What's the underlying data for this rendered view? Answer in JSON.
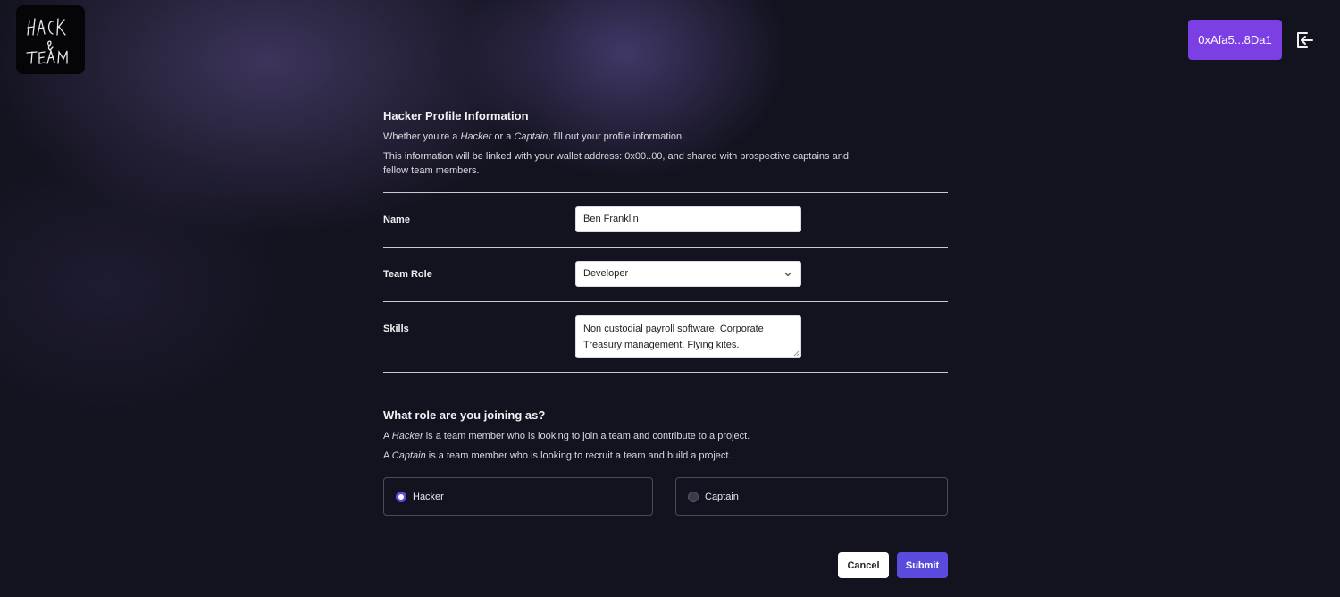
{
  "header": {
    "logo_text": "HACK & TEAM",
    "wallet_label": "0xAfa5...8Da1",
    "logout_icon": "logout-icon"
  },
  "profile": {
    "title": "Hacker Profile Information",
    "intro_prefix": "Whether you're a ",
    "intro_hacker": "Hacker",
    "intro_or": " or a ",
    "intro_captain": "Captain",
    "intro_suffix": ", fill out your profile information.",
    "wallet_note": "This information will be linked with your wallet address: 0x00..00, and shared with prospective captains and fellow team members."
  },
  "fields": {
    "name_label": "Name",
    "name_value": "Ben Franklin",
    "role_label": "Team Role",
    "role_value": "Developer",
    "skills_label": "Skills",
    "skills_value": "Non custodial payroll software. Corporate Treasury management. Flying kites."
  },
  "role_section": {
    "title": "What role are you joining as?",
    "hacker_a": "A ",
    "hacker_word": "Hacker",
    "hacker_desc": " is a team member who is looking to join a team and contribute to a project.",
    "captain_a": "A ",
    "captain_word": "Captain",
    "captain_desc": " is a team member who is looking to recruit a team and build a project.",
    "options": [
      {
        "label": "Hacker",
        "selected": true
      },
      {
        "label": "Captain",
        "selected": false
      }
    ]
  },
  "actions": {
    "cancel_label": "Cancel",
    "submit_label": "Submit"
  },
  "colors": {
    "accent": "#5b4bdc",
    "wallet_button": "#7b3fe4",
    "background": "#13131f"
  }
}
